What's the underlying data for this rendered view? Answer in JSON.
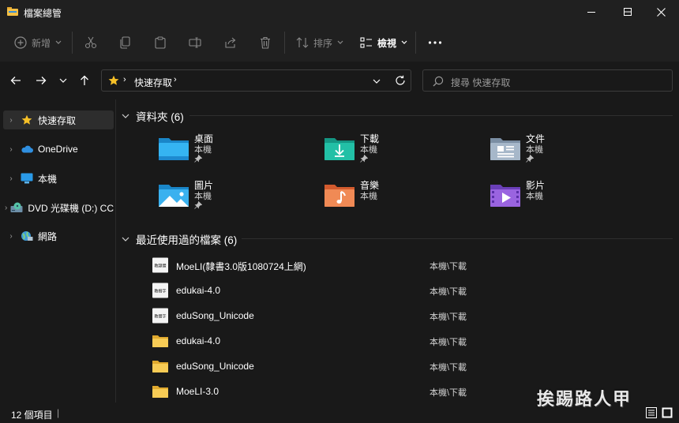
{
  "window": {
    "title": "檔案總管"
  },
  "toolbar": {
    "new_label": "新增",
    "sort_label": "排序",
    "view_label": "檢視"
  },
  "address": {
    "root": "快速存取"
  },
  "search": {
    "placeholder": "搜尋 快速存取"
  },
  "sidebar": {
    "items": [
      {
        "label": "快速存取",
        "icon": "star-icon"
      },
      {
        "label": "OneDrive",
        "icon": "cloud-icon"
      },
      {
        "label": "本機",
        "icon": "monitor-icon"
      },
      {
        "label": "DVD 光碟機 (D:) CC",
        "icon": "dvd-drive-icon"
      },
      {
        "label": "網路",
        "icon": "network-icon"
      }
    ]
  },
  "folders_group": {
    "title": "資料夾 (6)"
  },
  "folders": [
    {
      "name": "桌面",
      "sub": "本機",
      "pinned": true,
      "icon": "desktop-folder-icon"
    },
    {
      "name": "下載",
      "sub": "本機",
      "pinned": true,
      "icon": "downloads-folder-icon"
    },
    {
      "name": "文件",
      "sub": "本機",
      "pinned": true,
      "icon": "documents-folder-icon"
    },
    {
      "name": "圖片",
      "sub": "本機",
      "pinned": true,
      "icon": "pictures-folder-icon"
    },
    {
      "name": "音樂",
      "sub": "本機",
      "pinned": false,
      "icon": "music-folder-icon"
    },
    {
      "name": "影片",
      "sub": "本機",
      "pinned": false,
      "icon": "videos-folder-icon"
    }
  ],
  "recent_group": {
    "title": "最近使用過的檔案 (6)"
  },
  "recent_files": [
    {
      "name": "MoeLI(隸書3.0版1080724上網)",
      "location": "本機\\下載",
      "type": "font",
      "thumb": "教隸體"
    },
    {
      "name": "edukai-4.0",
      "location": "本機\\下載",
      "type": "font",
      "thumb": "教楷字"
    },
    {
      "name": "eduSong_Unicode",
      "location": "本機\\下載",
      "type": "font",
      "thumb": "教體字"
    },
    {
      "name": "edukai-4.0",
      "location": "本機\\下載",
      "type": "folder"
    },
    {
      "name": "eduSong_Unicode",
      "location": "本機\\下載",
      "type": "folder"
    },
    {
      "name": "MoeLI-3.0",
      "location": "本機\\下載",
      "type": "folder"
    }
  ],
  "status": {
    "count_text": "12 個項目",
    "cursor": "|"
  },
  "watermark": {
    "text": "挨踢路人甲"
  }
}
